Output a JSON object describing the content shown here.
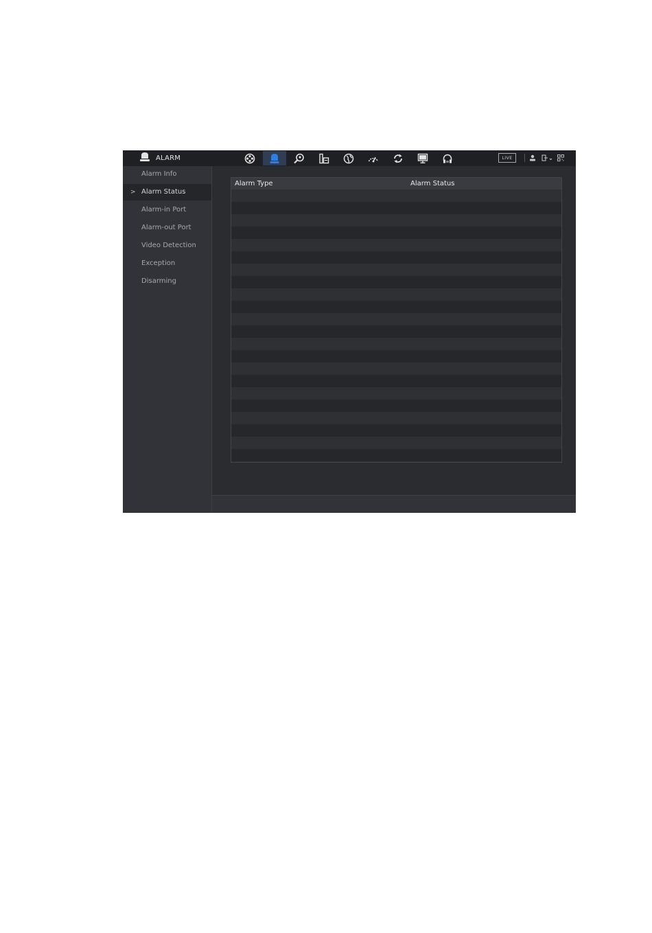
{
  "header": {
    "title": "ALARM",
    "title_icon": "alarm-bell-icon",
    "nav_icons": [
      "camera-reel-icon",
      "alarm-bell-icon",
      "search-icon",
      "storage-icon",
      "network-globe-icon",
      "performance-gauge-icon",
      "refresh-icon",
      "display-icon",
      "headset-icon"
    ],
    "active_nav": "alarm-bell-icon",
    "live_label": "LIVE",
    "right_icons": [
      "user-icon",
      "logout-icon",
      "qr-code-icon"
    ]
  },
  "sidebar": {
    "items": [
      {
        "label": "Alarm Info",
        "active": false
      },
      {
        "label": "Alarm Status",
        "active": true
      },
      {
        "label": "Alarm-in Port",
        "active": false
      },
      {
        "label": "Alarm-out Port",
        "active": false
      },
      {
        "label": "Video Detection",
        "active": false
      },
      {
        "label": "Exception",
        "active": false
      },
      {
        "label": "Disarming",
        "active": false
      }
    ],
    "active_marker": ">"
  },
  "table": {
    "columns": [
      "Alarm Type",
      "Alarm Status"
    ],
    "rows": []
  },
  "colors": {
    "accent": "#2d7fe3",
    "topbar": "#1f2024",
    "sidebar": "#323338",
    "content": "#2b2c30",
    "text": "#e6e6e6"
  }
}
